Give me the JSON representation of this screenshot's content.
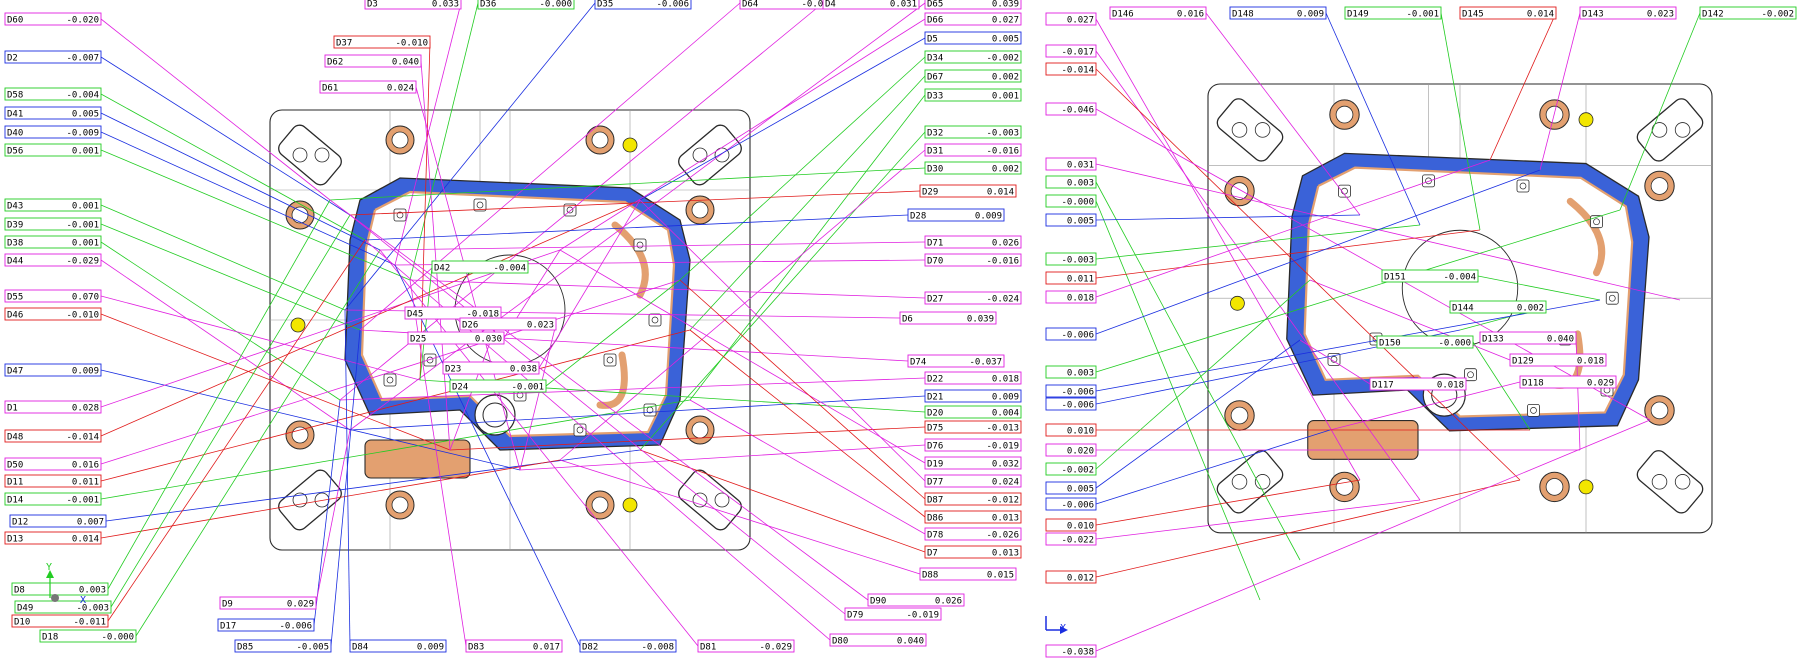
{
  "colors": {
    "magenta": "#e020e0",
    "blue": "#1a2ee0",
    "green": "#22cc22",
    "red": "#e01a1a",
    "part_blue": "#3a62d8",
    "copper": "#e3a070",
    "yellow": "#f2e600",
    "outline": "#2a2a2a"
  },
  "left_view": {
    "labels": [
      {
        "id": "D60",
        "value": "-0.020",
        "color": "magenta"
      },
      {
        "id": "D2",
        "value": "-0.007",
        "color": "blue"
      },
      {
        "id": "D58",
        "value": "-0.004",
        "color": "green"
      },
      {
        "id": "D41",
        "value": "0.005",
        "color": "blue"
      },
      {
        "id": "D40",
        "value": "-0.009",
        "color": "blue"
      },
      {
        "id": "D56",
        "value": "0.001",
        "color": "green"
      },
      {
        "id": "D43",
        "value": "0.001",
        "color": "green"
      },
      {
        "id": "D39",
        "value": "-0.001",
        "color": "green"
      },
      {
        "id": "D38",
        "value": "0.001",
        "color": "green"
      },
      {
        "id": "D44",
        "value": "-0.029",
        "color": "magenta"
      },
      {
        "id": "D55",
        "value": "0.070",
        "color": "magenta"
      },
      {
        "id": "D46",
        "value": "-0.010",
        "color": "red"
      },
      {
        "id": "D47",
        "value": "0.009",
        "color": "blue"
      },
      {
        "id": "D1",
        "value": "0.028",
        "color": "magenta"
      },
      {
        "id": "D48",
        "value": "-0.014",
        "color": "red"
      },
      {
        "id": "D50",
        "value": "0.016",
        "color": "magenta"
      },
      {
        "id": "D11",
        "value": "0.011",
        "color": "red"
      },
      {
        "id": "D14",
        "value": "-0.001",
        "color": "green"
      },
      {
        "id": "D12",
        "value": "0.007",
        "color": "blue"
      },
      {
        "id": "D13",
        "value": "0.014",
        "color": "red"
      },
      {
        "id": "D8",
        "value": "0.003",
        "color": "green"
      },
      {
        "id": "D49",
        "value": "-0.003",
        "color": "green"
      },
      {
        "id": "D10",
        "value": "-0.011",
        "color": "red"
      },
      {
        "id": "D18",
        "value": "-0.000",
        "color": "green"
      },
      {
        "id": "D3",
        "value": "0.033",
        "color": "magenta"
      },
      {
        "id": "D36",
        "value": "-0.000",
        "color": "green"
      },
      {
        "id": "D35",
        "value": "-0.006",
        "color": "blue"
      },
      {
        "id": "D64",
        "value": "-0.017",
        "color": "magenta"
      },
      {
        "id": "D4",
        "value": "0.031",
        "color": "magenta"
      },
      {
        "id": "D65",
        "value": "0.039",
        "color": "magenta"
      },
      {
        "id": "D37",
        "value": "-0.010",
        "color": "red"
      },
      {
        "id": "D62",
        "value": "0.040",
        "color": "magenta"
      },
      {
        "id": "D61",
        "value": "0.024",
        "color": "magenta"
      },
      {
        "id": "D66",
        "value": "0.027",
        "color": "magenta"
      },
      {
        "id": "D5",
        "value": "0.005",
        "color": "blue"
      },
      {
        "id": "D34",
        "value": "-0.002",
        "color": "green"
      },
      {
        "id": "D67",
        "value": "0.002",
        "color": "green"
      },
      {
        "id": "D33",
        "value": "0.001",
        "color": "green"
      },
      {
        "id": "D32",
        "value": "-0.003",
        "color": "green"
      },
      {
        "id": "D31",
        "value": "-0.016",
        "color": "magenta"
      },
      {
        "id": "D30",
        "value": "0.002",
        "color": "green"
      },
      {
        "id": "D29",
        "value": "0.014",
        "color": "red"
      },
      {
        "id": "D28",
        "value": "0.009",
        "color": "blue"
      },
      {
        "id": "D71",
        "value": "0.026",
        "color": "magenta"
      },
      {
        "id": "D70",
        "value": "-0.016",
        "color": "magenta"
      },
      {
        "id": "D27",
        "value": "-0.024",
        "color": "magenta"
      },
      {
        "id": "D6",
        "value": "0.039",
        "color": "magenta"
      },
      {
        "id": "D74",
        "value": "-0.037",
        "color": "magenta"
      },
      {
        "id": "D22",
        "value": "0.018",
        "color": "magenta"
      },
      {
        "id": "D21",
        "value": "0.009",
        "color": "blue"
      },
      {
        "id": "D20",
        "value": "0.004",
        "color": "green"
      },
      {
        "id": "D75",
        "value": "-0.013",
        "color": "red"
      },
      {
        "id": "D76",
        "value": "-0.019",
        "color": "magenta"
      },
      {
        "id": "D19",
        "value": "0.032",
        "color": "magenta"
      },
      {
        "id": "D77",
        "value": "0.024",
        "color": "magenta"
      },
      {
        "id": "D87",
        "value": "-0.012",
        "color": "red"
      },
      {
        "id": "D86",
        "value": "0.013",
        "color": "red"
      },
      {
        "id": "D78",
        "value": "-0.026",
        "color": "magenta"
      },
      {
        "id": "D7",
        "value": "0.013",
        "color": "red"
      },
      {
        "id": "D88",
        "value": "0.015",
        "color": "magenta"
      },
      {
        "id": "D90",
        "value": "0.026",
        "color": "magenta"
      },
      {
        "id": "D79",
        "value": "-0.019",
        "color": "magenta"
      },
      {
        "id": "D80",
        "value": "0.040",
        "color": "magenta"
      },
      {
        "id": "D81",
        "value": "-0.029",
        "color": "magenta"
      },
      {
        "id": "D82",
        "value": "-0.008",
        "color": "blue"
      },
      {
        "id": "D83",
        "value": "0.017",
        "color": "magenta"
      },
      {
        "id": "D84",
        "value": "0.009",
        "color": "blue"
      },
      {
        "id": "D85",
        "value": "-0.005",
        "color": "blue"
      },
      {
        "id": "D17",
        "value": "-0.006",
        "color": "blue"
      },
      {
        "id": "D9",
        "value": "0.029",
        "color": "magenta"
      },
      {
        "id": "D42",
        "value": "-0.004",
        "color": "green"
      },
      {
        "id": "D45",
        "value": "-0.018",
        "color": "magenta"
      },
      {
        "id": "D26",
        "value": "0.023",
        "color": "magenta"
      },
      {
        "id": "D25",
        "value": "0.030",
        "color": "magenta"
      },
      {
        "id": "D23",
        "value": "0.038",
        "color": "magenta"
      },
      {
        "id": "D24",
        "value": "-0.001",
        "color": "green"
      }
    ],
    "axis_y": "Y",
    "axis_x": "X"
  },
  "right_view": {
    "labels": [
      {
        "id": "D146",
        "value": "0.016",
        "color": "magenta"
      },
      {
        "id": "D148",
        "value": "0.009",
        "color": "blue"
      },
      {
        "id": "D149",
        "value": "-0.001",
        "color": "green"
      },
      {
        "id": "D145",
        "value": "0.014",
        "color": "red"
      },
      {
        "id": "D143",
        "value": "0.023",
        "color": "magenta"
      },
      {
        "id": "D142",
        "value": "-0.002",
        "color": "green"
      },
      {
        "id": "D151",
        "value": "-0.004",
        "color": "green"
      },
      {
        "id": "D144",
        "value": "0.002",
        "color": "green"
      },
      {
        "id": "D150",
        "value": "-0.000",
        "color": "green"
      },
      {
        "id": "D133",
        "value": "0.040",
        "color": "magenta"
      },
      {
        "id": "D129",
        "value": "0.018",
        "color": "magenta"
      },
      {
        "id": "D117",
        "value": "0.018",
        "color": "magenta"
      },
      {
        "id": "D118",
        "value": "0.029",
        "color": "magenta"
      },
      {
        "id": "",
        "value": "0.027",
        "color": "magenta"
      },
      {
        "id": "",
        "value": "-0.017",
        "color": "magenta"
      },
      {
        "id": "",
        "value": "-0.014",
        "color": "red"
      },
      {
        "id": "",
        "value": "-0.046",
        "color": "magenta"
      },
      {
        "id": "",
        "value": "0.031",
        "color": "magenta"
      },
      {
        "id": "",
        "value": "0.003",
        "color": "green"
      },
      {
        "id": "",
        "value": "-0.000",
        "color": "green"
      },
      {
        "id": "",
        "value": "0.005",
        "color": "blue"
      },
      {
        "id": "",
        "value": "-0.003",
        "color": "green"
      },
      {
        "id": "",
        "value": "0.011",
        "color": "red"
      },
      {
        "id": "",
        "value": "0.018",
        "color": "magenta"
      },
      {
        "id": "",
        "value": "-0.006",
        "color": "blue"
      },
      {
        "id": "",
        "value": "0.003",
        "color": "green"
      },
      {
        "id": "",
        "value": "-0.006",
        "color": "blue"
      },
      {
        "id": "",
        "value": "-0.006",
        "color": "blue"
      },
      {
        "id": "",
        "value": "0.010",
        "color": "red"
      },
      {
        "id": "",
        "value": "0.020",
        "color": "magenta"
      },
      {
        "id": "",
        "value": "-0.002",
        "color": "green"
      },
      {
        "id": "",
        "value": "0.005",
        "color": "blue"
      },
      {
        "id": "",
        "value": "-0.006",
        "color": "blue"
      },
      {
        "id": "",
        "value": "0.010",
        "color": "red"
      },
      {
        "id": "",
        "value": "-0.022",
        "color": "magenta"
      },
      {
        "id": "",
        "value": "0.012",
        "color": "red"
      },
      {
        "id": "",
        "value": "-0.038",
        "color": "magenta"
      }
    ],
    "axis_x": "X"
  }
}
